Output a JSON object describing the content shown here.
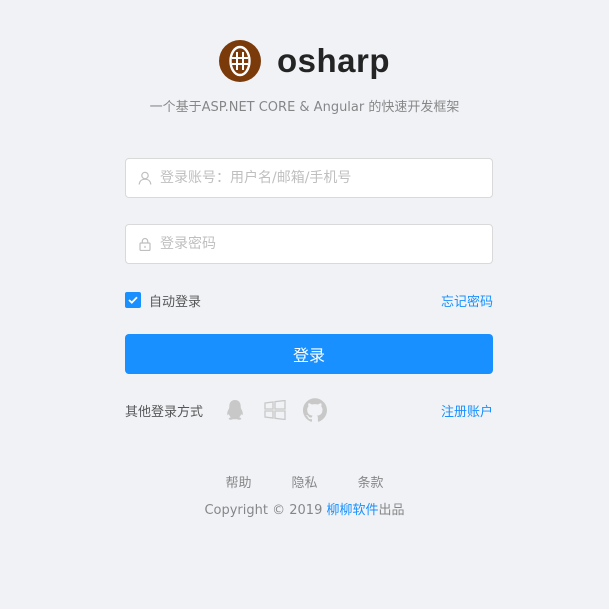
{
  "app": {
    "title": "osharp",
    "logo_icon": "osharp-logo-icon",
    "description": "一个基于ASP.NET CORE & Angular 的快速开发框架"
  },
  "colors": {
    "primary": "#1890ff",
    "logo": "#7a3a0a",
    "background": "#f0f2f5"
  },
  "form": {
    "username": {
      "icon": "user-icon",
      "placeholder": "登录账号：用户名/邮箱/手机号",
      "value": ""
    },
    "password": {
      "icon": "lock-icon",
      "placeholder": "登录密码",
      "value": ""
    },
    "remember_label": "自动登录",
    "remember_checked": true,
    "forgot_label": "忘记密码",
    "submit_label": "登录"
  },
  "other_login": {
    "label": "其他登录方式",
    "icons": [
      "qq-icon",
      "windows-icon",
      "github-icon"
    ]
  },
  "register_label": "注册账户",
  "footer": {
    "links": [
      "帮助",
      "隐私",
      "条款"
    ],
    "copyright_prefix": "Copyright",
    "copyright_symbol": "©",
    "copyright_year": "2019",
    "company": "柳柳软件",
    "copyright_suffix": "出品"
  }
}
